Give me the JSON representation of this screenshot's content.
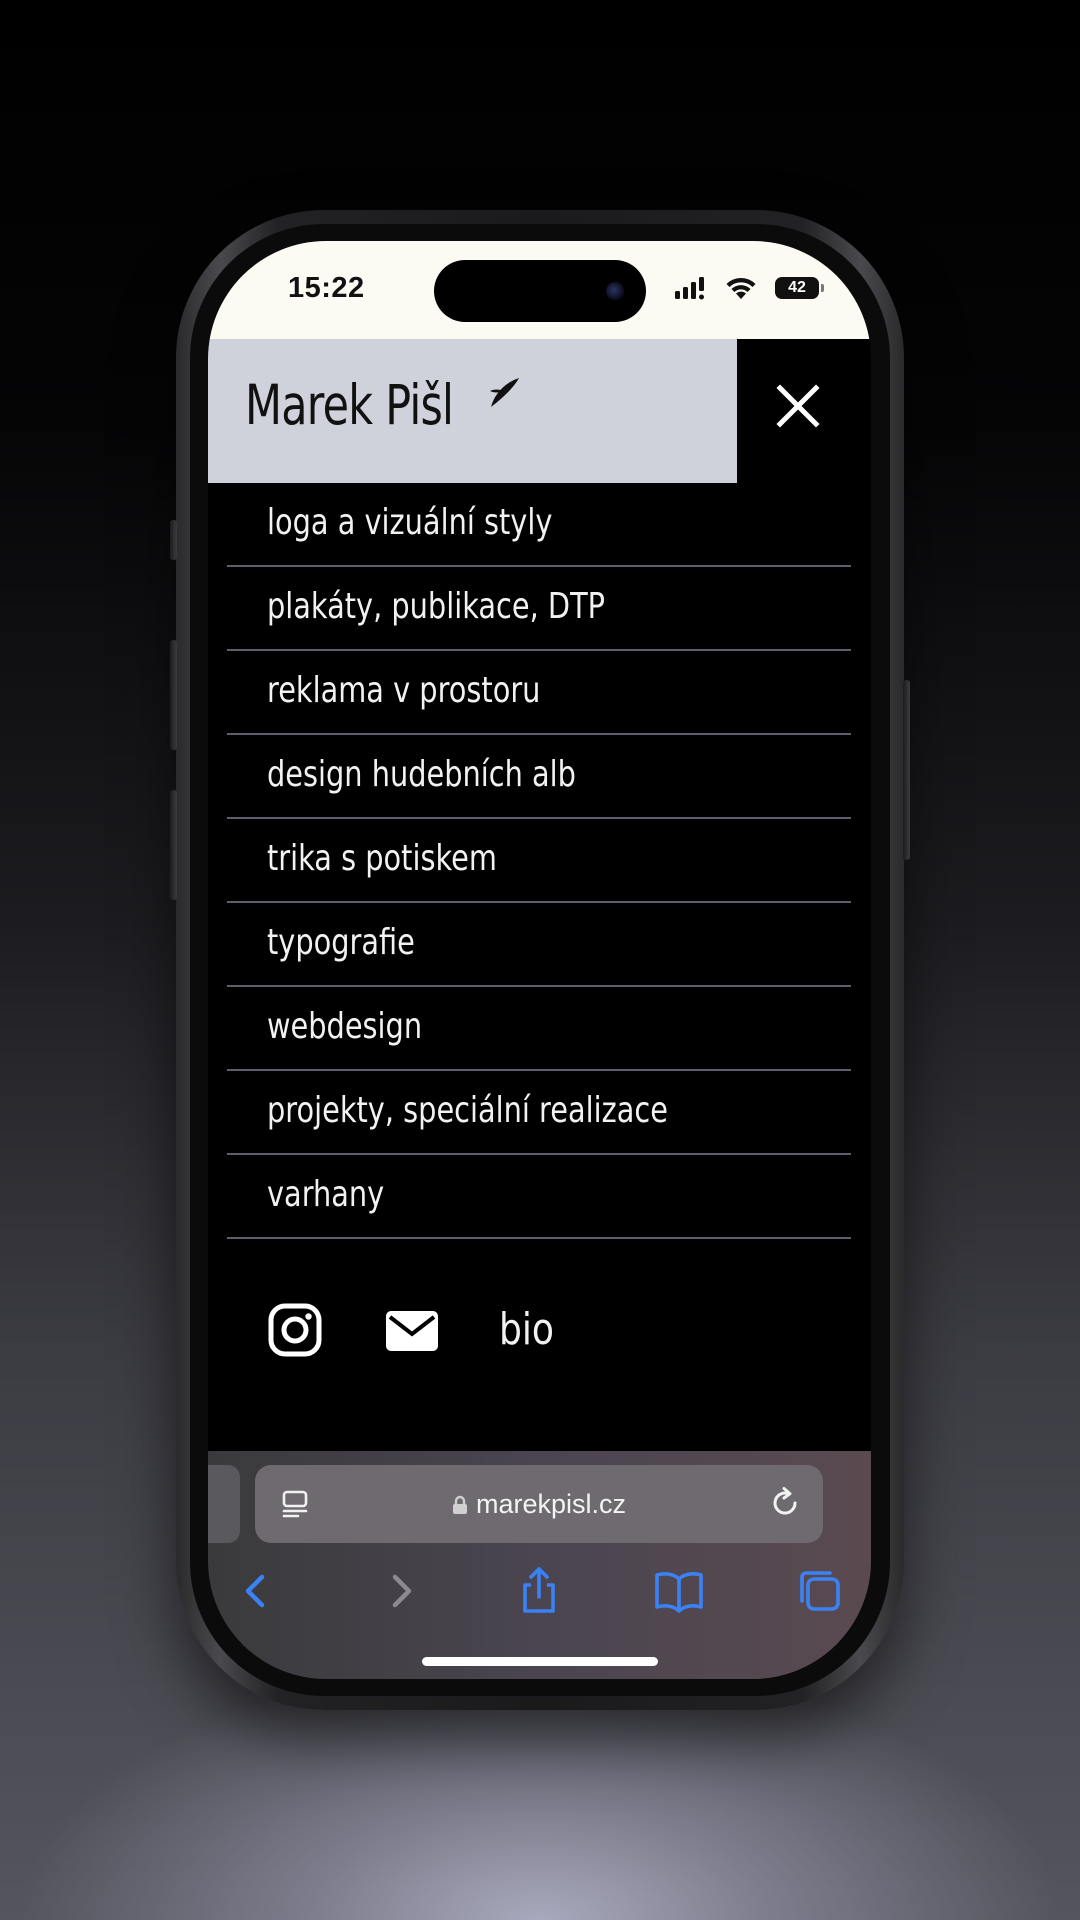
{
  "status_bar": {
    "time": "15:22",
    "battery": "42"
  },
  "header": {
    "brand": "Marek Pišl",
    "close_icon": "close-icon"
  },
  "nav": {
    "items": [
      {
        "label": "loga a vizuální styly"
      },
      {
        "label": "plakáty, publikace, DTP"
      },
      {
        "label": "reklama v prostoru"
      },
      {
        "label": "design hudebních alb"
      },
      {
        "label": "trika s potiskem"
      },
      {
        "label": "typografie"
      },
      {
        "label": "webdesign"
      },
      {
        "label": "projekty, speciální realizace"
      },
      {
        "label": "varhany"
      }
    ]
  },
  "social": {
    "instagram_icon": "instagram-icon",
    "mail_icon": "mail-icon",
    "bio_label": "bio"
  },
  "browser": {
    "url": "marekpisl.cz",
    "toolbar_icons": [
      "back-icon",
      "forward-icon",
      "share-icon",
      "bookmarks-icon",
      "tabs-icon"
    ]
  },
  "colors": {
    "header_bg": "#cfd2db",
    "menu_bg": "#000000",
    "divider": "#5d5f6c",
    "status_bar_bg": "#fbfaf3",
    "safari_accent": "#3b82f6"
  }
}
